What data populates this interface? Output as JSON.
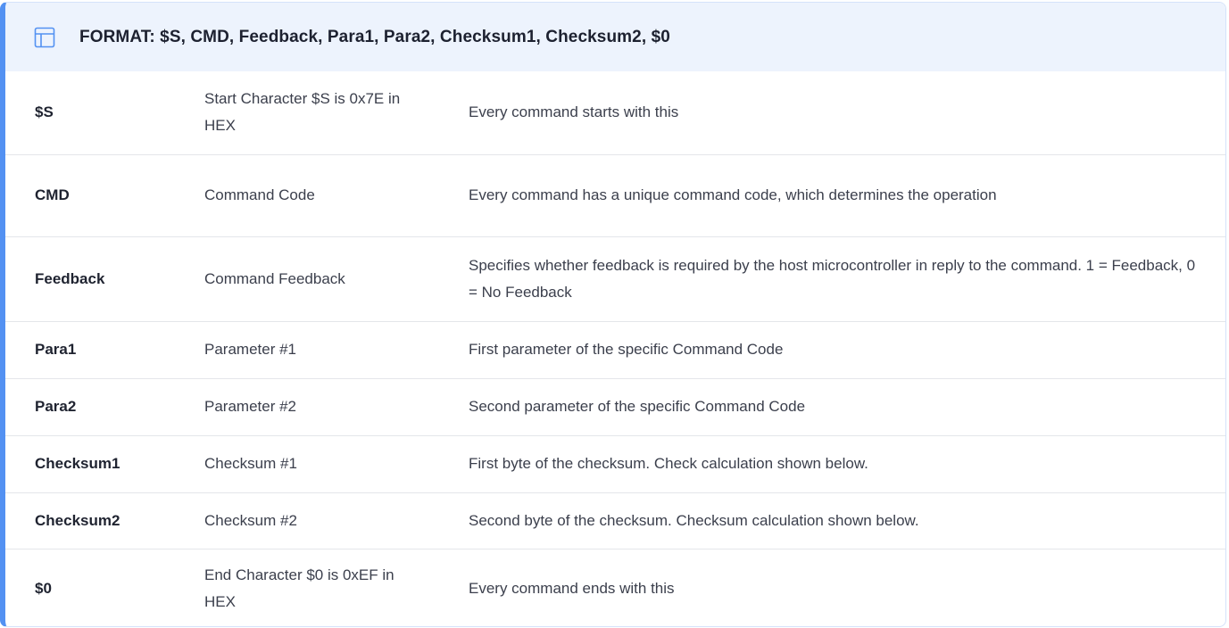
{
  "header": {
    "icon": "table-icon",
    "title": "FORMAT: $S, CMD, Feedback, Para1, Para2, Checksum1, Checksum2, $0"
  },
  "colors": {
    "accent": "#5391f2",
    "header_bg": "#edf3fd",
    "border": "#d5e2fa"
  },
  "rows": [
    {
      "field": "$S",
      "name": "Start Character $S is 0x7E in HEX",
      "description": "Every command starts with this"
    },
    {
      "field": "CMD",
      "name": "Command Code",
      "description": "Every command has a unique command code, which determines the operation"
    },
    {
      "field": "Feedback",
      "name": "Command Feedback",
      "description": "Specifies whether feedback is required by the host microcontroller in reply to the command. 1 = Feedback, 0 = No Feedback"
    },
    {
      "field": "Para1",
      "name": "Parameter #1",
      "description": "First parameter of the specific Command Code"
    },
    {
      "field": "Para2",
      "name": "Parameter #2",
      "description": "Second parameter of the specific Command Code"
    },
    {
      "field": "Checksum1",
      "name": "Checksum #1",
      "description": "First byte of the checksum. Check calculation shown below."
    },
    {
      "field": "Checksum2",
      "name": "Checksum #2",
      "description": "Second byte of the checksum. Checksum calculation shown below."
    },
    {
      "field": "$0",
      "name": "End Character $0 is 0xEF in HEX",
      "description": "Every command ends with this"
    }
  ]
}
